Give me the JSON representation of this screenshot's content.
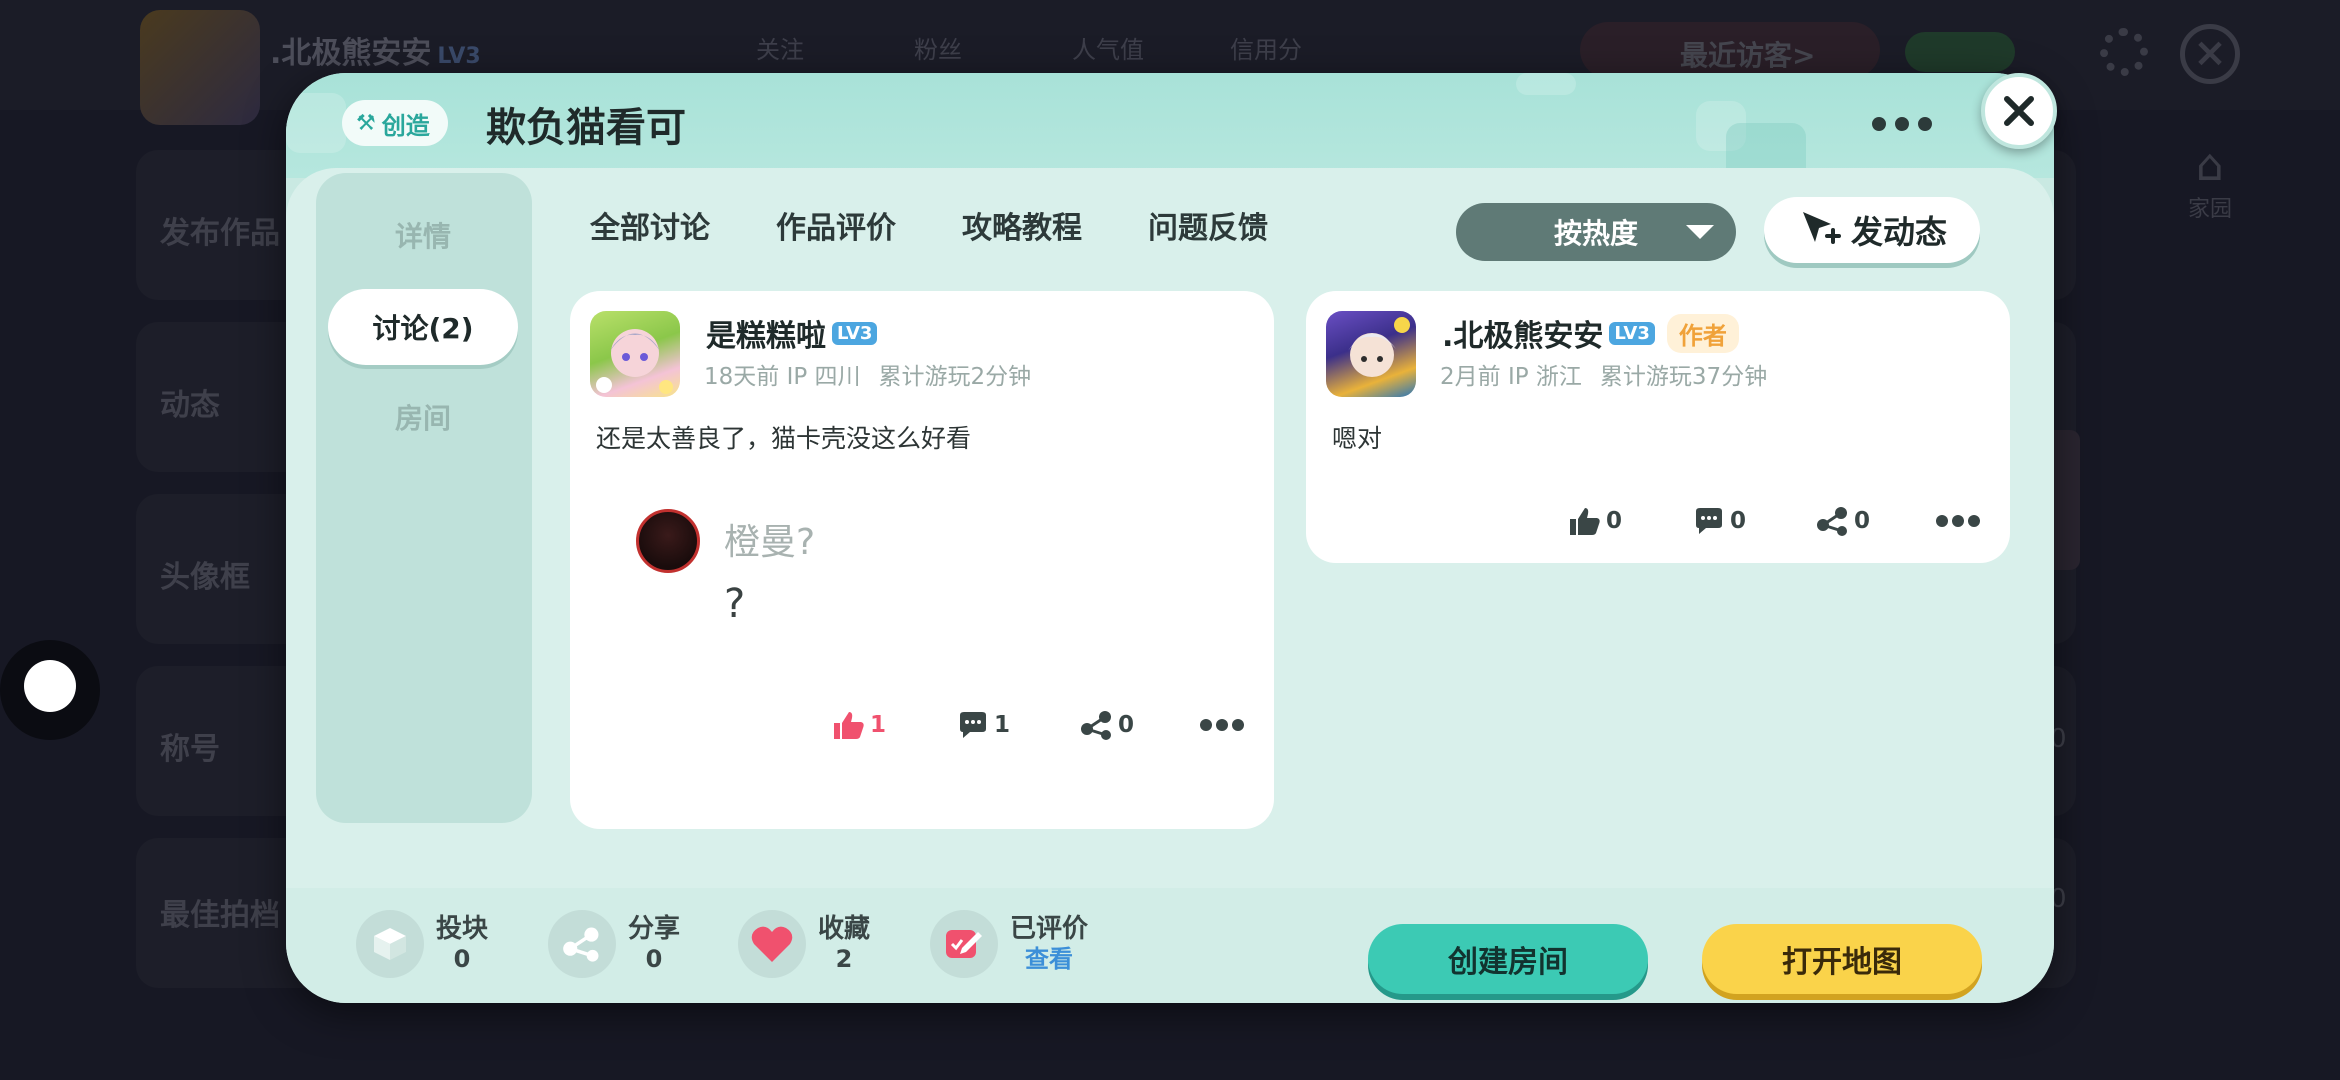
{
  "background": {
    "profile_name": ".北极熊安安",
    "profile_level": "LV3",
    "top_tabs": [
      "关注",
      "粉丝",
      "人气值",
      "信用分"
    ],
    "visitors_label": "最近访客>",
    "home_label": "家园",
    "rows": [
      {
        "label": "发布作品",
        "num": ""
      },
      {
        "label": "动态",
        "num": ""
      },
      {
        "label": "头像框",
        "num": ""
      },
      {
        "label": "称号",
        "num": "0"
      },
      {
        "label": "最佳拍档",
        "num": "0"
      }
    ]
  },
  "dialog": {
    "tag_label": "创造",
    "title": "欺负猫看可",
    "sidebar": [
      {
        "label": "详情",
        "active": false
      },
      {
        "label": "讨论(2)",
        "active": true
      },
      {
        "label": "房间",
        "active": false
      }
    ],
    "tabs": [
      "全部讨论",
      "作品评价",
      "攻略教程",
      "问题反馈"
    ],
    "sort_label": "按热度",
    "post_button": "发动态",
    "posts": [
      {
        "user": "是糕糕啦",
        "level": "LV3",
        "author": "",
        "time": "18天前 IP 四川",
        "playtime": "累计游玩2分钟",
        "content": "还是太善良了，猫卡壳没这么好看",
        "reply_name": "橙曼?",
        "reply_text": "?",
        "likes": "1",
        "comments": "1",
        "shares": "0"
      },
      {
        "user": ".北极熊安安",
        "level": "LV3",
        "author": "作者",
        "time": "2月前 IP 浙江",
        "playtime": "累计游玩37分钟",
        "content": "嗯对",
        "likes": "0",
        "comments": "0",
        "shares": "0"
      }
    ],
    "footer": {
      "stats": [
        {
          "label": "投块",
          "value": "0",
          "icon": "block-icon"
        },
        {
          "label": "分享",
          "value": "0",
          "icon": "share-icon"
        },
        {
          "label": "收藏",
          "value": "2",
          "icon": "heart-icon"
        },
        {
          "label": "已评价",
          "value": "查看",
          "icon": "review-icon"
        }
      ],
      "create_room": "创建房间",
      "open_map": "打开地图"
    }
  },
  "colors": {
    "accent_teal": "#3ccab4",
    "accent_yellow": "#fad34a",
    "like_pink": "#f0516e",
    "dialog_bg": "#c9e9e2"
  }
}
